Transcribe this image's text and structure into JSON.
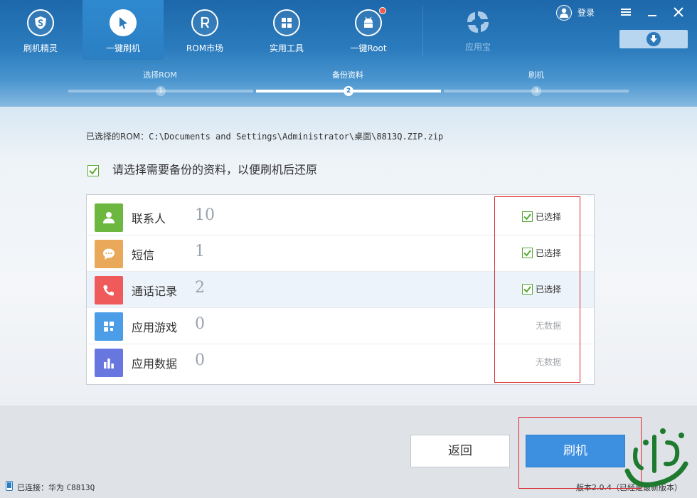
{
  "nav": {
    "items": [
      {
        "label": "刷机精灵",
        "icon": "shield-s-icon"
      },
      {
        "label": "一键刷机",
        "icon": "cursor-icon",
        "active": true
      },
      {
        "label": "ROM市场",
        "icon": "rom-r-icon"
      },
      {
        "label": "实用工具",
        "icon": "grid-icon"
      },
      {
        "label": "一键Root",
        "icon": "android-icon",
        "badge": true
      },
      {
        "label": "应用宝",
        "icon": "appstore-icon",
        "disabled": true
      }
    ]
  },
  "header": {
    "login_label": "登录"
  },
  "steps": [
    {
      "label": "选择ROM",
      "num": "1"
    },
    {
      "label": "备份资料",
      "num": "2",
      "active": true
    },
    {
      "label": "刷机",
      "num": "3"
    }
  ],
  "rom": {
    "label": "已选择的ROM：",
    "path": "C:\\Documents and Settings\\Administrator\\桌面\\8813Q.ZIP.zip"
  },
  "instruction": "请选择需要备份的资料，以便刷机后还原",
  "backup_items": [
    {
      "name": "联系人",
      "count": "10",
      "status": "已选择",
      "checked": true,
      "color": "#6cb73f",
      "icon": "contact-icon"
    },
    {
      "name": "短信",
      "count": "1",
      "status": "已选择",
      "checked": true,
      "color": "#e9a85a",
      "icon": "message-icon"
    },
    {
      "name": "通话记录",
      "count": "2",
      "status": "已选择",
      "checked": true,
      "color": "#ef5a5a",
      "icon": "phone-icon"
    },
    {
      "name": "应用游戏",
      "count": "0",
      "status": "无数据",
      "checked": false,
      "color": "#4a9de6",
      "icon": "apps-icon"
    },
    {
      "name": "应用数据",
      "count": "0",
      "status": "无数据",
      "checked": false,
      "color": "#6877e0",
      "icon": "chart-icon"
    }
  ],
  "buttons": {
    "back": "返回",
    "flash": "刷机"
  },
  "status": {
    "connection": "已连接：华为 ",
    "model": "C8813Q",
    "version": "版本2.0.4（已经是最新版本）"
  },
  "colors": {
    "accent": "#3d8fe0",
    "header": "#2a7bbd",
    "check": "#5aa832",
    "highlight_box": "#d9262b"
  }
}
